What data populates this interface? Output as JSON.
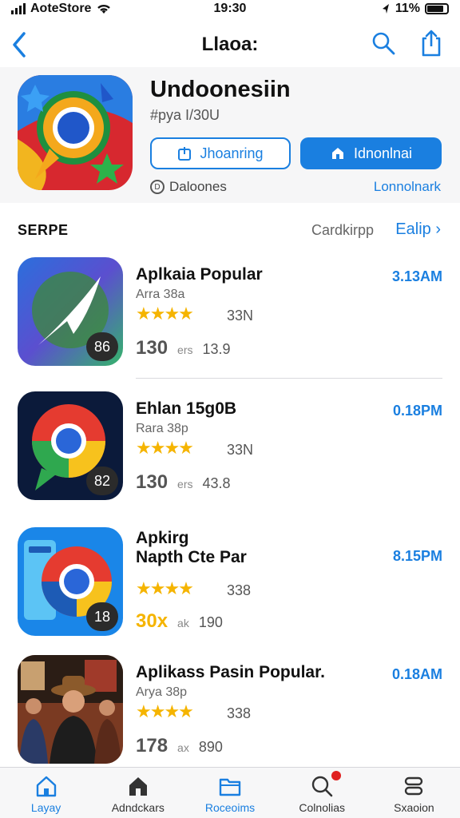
{
  "status_bar": {
    "carrier": "AoteStore",
    "time": "19:30",
    "battery": "11%"
  },
  "nav": {
    "title": "Llaoa:"
  },
  "hero": {
    "app_name": "Undoonesiin",
    "subtitle": "#pya I/30U",
    "outline_button": "Jhoanring",
    "fill_button": "Idnonlnai",
    "meta_left": "Daloones",
    "meta_right": "Lonnolnark"
  },
  "section": {
    "title": "SERPE",
    "middle": "Cardkirpp",
    "link": "Ealip"
  },
  "items": [
    {
      "title": "Aplkaia Popular",
      "sub": "Arra 38a",
      "stars": "★★★★",
      "rating_count": "33N",
      "badge": "86",
      "stat_big": "130",
      "stat_small": "ers",
      "stat_num": "13.9",
      "time": "3.13AM"
    },
    {
      "title": "Ehlan 15g0B",
      "sub": "Rara 38p",
      "stars": "★★★★",
      "rating_count": "33N",
      "badge": "82",
      "stat_big": "130",
      "stat_small": "ers",
      "stat_num": "43.8",
      "time": "0.18PM"
    },
    {
      "title": "Apkirg\nNapth Cte Par",
      "sub": "",
      "stars": "★★★★",
      "rating_count": "338",
      "badge": "18",
      "stat_big": "30x",
      "stat_small": "ak",
      "stat_num": "190",
      "time": "8.15PM"
    },
    {
      "title": "Aplikass Pasin Popular.",
      "sub": "Arya 38p",
      "stars": "★★★★",
      "rating_count": "338",
      "badge": "",
      "stat_big": "178",
      "stat_small": "ax",
      "stat_num": "890",
      "time": "0.18AM"
    }
  ],
  "tabs": [
    {
      "label": "Layay",
      "icon": "home-icon"
    },
    {
      "label": "Adndckars",
      "icon": "house-filled-icon"
    },
    {
      "label": "Roceoims",
      "icon": "folder-icon"
    },
    {
      "label": "Colnolias",
      "icon": "search-icon"
    },
    {
      "label": "Sxaoion",
      "icon": "stack-icon"
    }
  ],
  "colors": {
    "accent": "#1a7fe0",
    "star": "#f5b400",
    "badge_bg": "#2b2b2b"
  }
}
